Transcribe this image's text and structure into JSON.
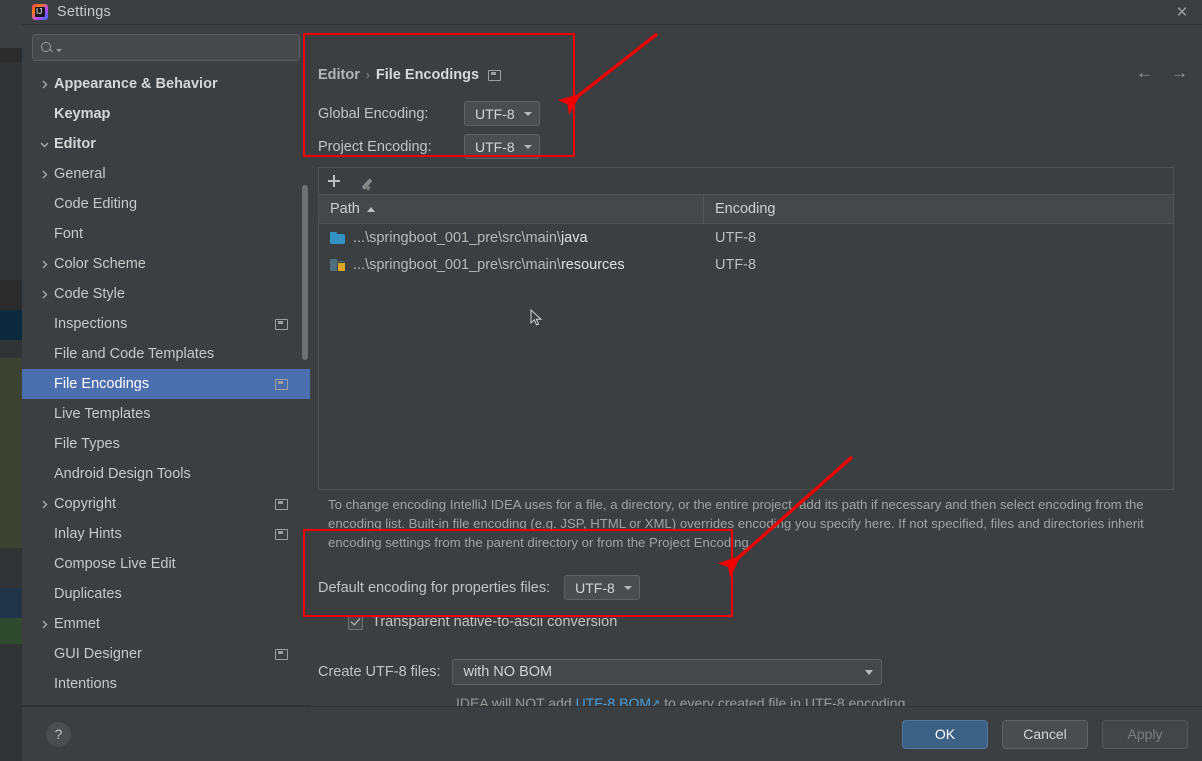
{
  "window": {
    "title": "Settings",
    "app_icon": "intellij-idea-icon",
    "close_icon": "close-icon"
  },
  "sidebar": {
    "search": {
      "placeholder": "",
      "value": "",
      "icon": "search-icon"
    },
    "items": [
      {
        "label": "Appearance & Behavior",
        "indent": 0,
        "expandable": true,
        "expanded": false,
        "bold": true,
        "selected": false,
        "config_icon": false
      },
      {
        "label": "Keymap",
        "indent": 0,
        "expandable": false,
        "expanded": false,
        "bold": true,
        "selected": false,
        "config_icon": false
      },
      {
        "label": "Editor",
        "indent": 0,
        "expandable": true,
        "expanded": true,
        "bold": true,
        "selected": false,
        "config_icon": false
      },
      {
        "label": "General",
        "indent": 1,
        "expandable": true,
        "expanded": false,
        "bold": false,
        "selected": false,
        "config_icon": false
      },
      {
        "label": "Code Editing",
        "indent": 1,
        "expandable": false,
        "expanded": false,
        "bold": false,
        "selected": false,
        "config_icon": false
      },
      {
        "label": "Font",
        "indent": 1,
        "expandable": false,
        "expanded": false,
        "bold": false,
        "selected": false,
        "config_icon": false
      },
      {
        "label": "Color Scheme",
        "indent": 1,
        "expandable": true,
        "expanded": false,
        "bold": false,
        "selected": false,
        "config_icon": false
      },
      {
        "label": "Code Style",
        "indent": 1,
        "expandable": true,
        "expanded": false,
        "bold": false,
        "selected": false,
        "config_icon": false
      },
      {
        "label": "Inspections",
        "indent": 1,
        "expandable": false,
        "expanded": false,
        "bold": false,
        "selected": false,
        "config_icon": true
      },
      {
        "label": "File and Code Templates",
        "indent": 1,
        "expandable": false,
        "expanded": false,
        "bold": false,
        "selected": false,
        "config_icon": false
      },
      {
        "label": "File Encodings",
        "indent": 1,
        "expandable": false,
        "expanded": false,
        "bold": false,
        "selected": true,
        "config_icon": true
      },
      {
        "label": "Live Templates",
        "indent": 1,
        "expandable": false,
        "expanded": false,
        "bold": false,
        "selected": false,
        "config_icon": false
      },
      {
        "label": "File Types",
        "indent": 1,
        "expandable": false,
        "expanded": false,
        "bold": false,
        "selected": false,
        "config_icon": false
      },
      {
        "label": "Android Design Tools",
        "indent": 1,
        "expandable": false,
        "expanded": false,
        "bold": false,
        "selected": false,
        "config_icon": false
      },
      {
        "label": "Copyright",
        "indent": 1,
        "expandable": true,
        "expanded": false,
        "bold": false,
        "selected": false,
        "config_icon": true
      },
      {
        "label": "Inlay Hints",
        "indent": 1,
        "expandable": false,
        "expanded": false,
        "bold": false,
        "selected": false,
        "config_icon": true
      },
      {
        "label": "Compose Live Edit",
        "indent": 1,
        "expandable": false,
        "expanded": false,
        "bold": false,
        "selected": false,
        "config_icon": false
      },
      {
        "label": "Duplicates",
        "indent": 1,
        "expandable": false,
        "expanded": false,
        "bold": false,
        "selected": false,
        "config_icon": false
      },
      {
        "label": "Emmet",
        "indent": 1,
        "expandable": true,
        "expanded": false,
        "bold": false,
        "selected": false,
        "config_icon": false
      },
      {
        "label": "GUI Designer",
        "indent": 1,
        "expandable": false,
        "expanded": false,
        "bold": false,
        "selected": false,
        "config_icon": true
      },
      {
        "label": "Intentions",
        "indent": 1,
        "expandable": false,
        "expanded": false,
        "bold": false,
        "selected": false,
        "config_icon": false
      }
    ]
  },
  "main": {
    "breadcrumb": {
      "parent": "Editor",
      "separator": "›",
      "current": "File Encodings",
      "config_icon": "settings-sync-icon"
    },
    "nav": {
      "back": "←",
      "forward": "→"
    },
    "global_encoding": {
      "label": "Global Encoding:",
      "value": "UTF-8"
    },
    "project_encoding": {
      "label": "Project Encoding:",
      "value": "UTF-8"
    },
    "toolbar": {
      "add_icon": "plus-icon",
      "edit_icon": "pencil-icon"
    },
    "table": {
      "columns": [
        "Path",
        "Encoding"
      ],
      "sort_column": "Path",
      "sort_direction": "asc",
      "rows": [
        {
          "path_prefix": "...\\springboot_001_pre\\src\\main\\",
          "path_tail": "java",
          "encoding": "UTF-8",
          "icon": "folder-icon"
        },
        {
          "path_prefix": "...\\springboot_001_pre\\src\\main\\",
          "path_tail": "resources",
          "encoding": "UTF-8",
          "icon": "resources-folder-icon"
        }
      ]
    },
    "help_text": "To change encoding IntelliJ IDEA uses for a file, a directory, or the entire project, add its path if necessary and then select encoding from the encoding list. Built-in file encoding (e.g. JSP, HTML or XML) overrides encoding you specify here. If not specified, files and directories inherit encoding settings from the parent directory or from the Project Encoding.",
    "properties_encoding": {
      "label": "Default encoding for properties files:",
      "value": "UTF-8"
    },
    "transparent_conversion": {
      "label": "Transparent native-to-ascii conversion",
      "checked": true
    },
    "create_utf8": {
      "label": "Create UTF-8 files:",
      "value": "with NO BOM"
    },
    "bom_note": {
      "before": "IDEA will NOT add ",
      "link": "UTF-8 BOM",
      "link_icon": "external-link-icon",
      "after": " to every created file in UTF-8 encoding"
    }
  },
  "footer": {
    "help_label": "?",
    "ok_label": "OK",
    "cancel_label": "Cancel",
    "apply_label": "Apply",
    "apply_enabled": false
  },
  "annotations": {
    "color": "#f00000",
    "boxes": [
      {
        "name": "encoding-settings-highlight"
      },
      {
        "name": "properties-encoding-highlight"
      }
    ],
    "arrows": [
      {
        "name": "arrow-to-encoding-settings"
      },
      {
        "name": "arrow-to-properties-encoding"
      }
    ]
  }
}
